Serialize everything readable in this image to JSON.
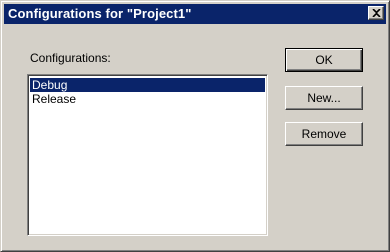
{
  "window": {
    "title": "Configurations for \"Project1\"",
    "close_icon": "close-icon"
  },
  "configurations": {
    "label": "Configurations:",
    "items": [
      "Debug",
      "Release"
    ],
    "selected": "Debug"
  },
  "buttons": {
    "ok": "OK",
    "new": "New...",
    "remove": "Remove"
  },
  "colors": {
    "titlebar": "#0a246a",
    "face": "#d4d0c8",
    "selection": "#0a246a"
  }
}
